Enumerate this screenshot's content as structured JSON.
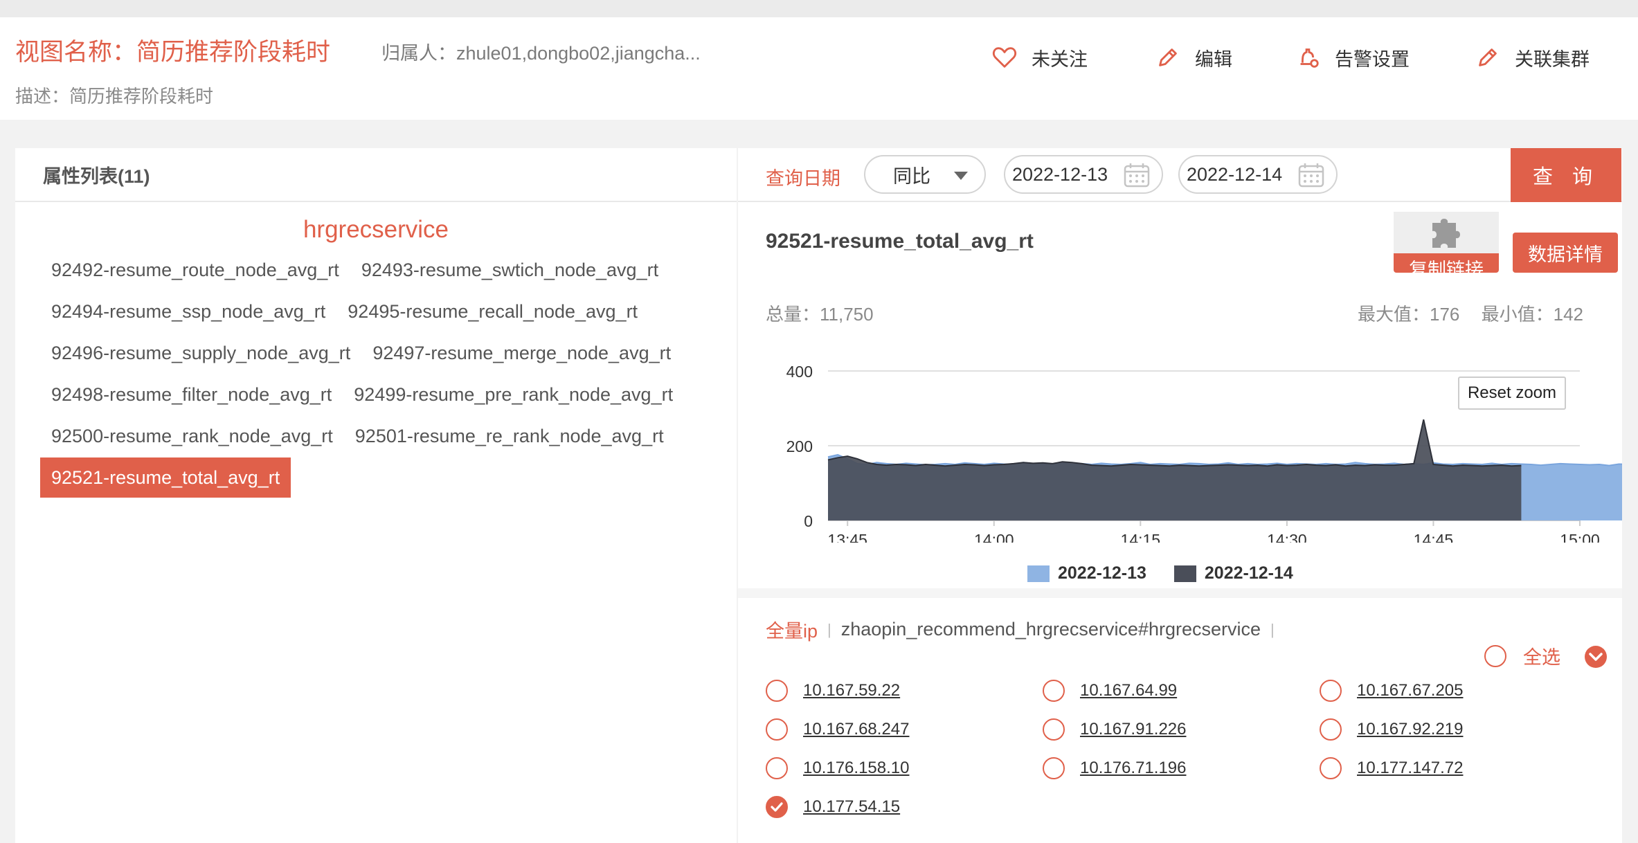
{
  "header": {
    "view_title": "视图名称：简历推荐阶段耗时",
    "owner": "归属人：zhule01,dongbo02,jiangcha...",
    "description": "描述：简历推荐阶段耗时",
    "actions": {
      "follow": "未关注",
      "edit": "编辑",
      "alert": "告警设置",
      "cluster": "关联集群"
    }
  },
  "left": {
    "list_title": "属性列表(11)",
    "service": "hrgrecservice",
    "attributes": [
      "92492-resume_route_node_avg_rt",
      "92493-resume_swtich_node_avg_rt",
      "92494-resume_ssp_node_avg_rt",
      "92495-resume_recall_node_avg_rt",
      "92496-resume_supply_node_avg_rt",
      "92497-resume_merge_node_avg_rt",
      "92498-resume_filter_node_avg_rt",
      "92499-resume_pre_rank_node_avg_rt",
      "92500-resume_rank_node_avg_rt",
      "92501-resume_re_rank_node_avg_rt",
      "92521-resume_total_avg_rt"
    ],
    "selected_index": 10
  },
  "query": {
    "label": "查询日期",
    "compare_mode": "同比",
    "date_a": "2022-12-13",
    "date_b": "2022-12-14",
    "button": "查 询"
  },
  "metric": {
    "title": "92521-resume_total_avg_rt",
    "copy_link": "复制链接",
    "detail": "数据详情",
    "total": "总量：11,750",
    "max": "最大值：176",
    "min": "最小值：142",
    "reset_zoom": "Reset zoom"
  },
  "chart_data": {
    "type": "area",
    "x_ticks": [
      "13:45",
      "14:00",
      "14:15",
      "14:30",
      "14:45",
      "15:00"
    ],
    "y_ticks": [
      "400",
      "200",
      "0"
    ],
    "ylim": [
      0,
      400
    ],
    "grid": true,
    "legend_position": "bottom",
    "series": [
      {
        "name": "2022-12-13",
        "color": "#8fb4e3",
        "x_start": "13:43",
        "x_step_min": 1,
        "values": [
          170,
          176,
          165,
          152,
          150,
          155,
          152,
          150,
          153,
          151,
          149,
          150,
          152,
          150,
          154,
          152,
          150,
          153,
          151,
          150,
          155,
          152,
          150,
          151,
          154,
          150,
          152,
          150,
          153,
          151,
          150,
          152,
          155,
          150,
          152,
          151,
          150,
          153,
          152,
          150,
          151,
          154,
          150,
          152,
          150,
          151,
          153,
          150,
          152,
          151,
          150,
          152,
          150,
          151,
          155,
          152,
          150,
          151,
          153,
          150,
          152,
          150,
          154,
          151,
          150,
          152,
          151,
          150,
          153,
          150,
          152,
          151,
          150,
          148,
          150,
          152,
          151,
          150,
          149,
          150,
          147,
          151,
          150,
          149
        ]
      },
      {
        "name": "2022-12-14",
        "color": "#4a4e59",
        "x_start": "13:43",
        "x_step_min": 1,
        "values": [
          162,
          168,
          172,
          165,
          155,
          150,
          148,
          150,
          149,
          147,
          150,
          148,
          146,
          148,
          150,
          149,
          147,
          149,
          150,
          152,
          155,
          153,
          154,
          152,
          157,
          155,
          152,
          148,
          147,
          146,
          148,
          150,
          149,
          148,
          147,
          146,
          148,
          147,
          146,
          147,
          148,
          149,
          148,
          147,
          148,
          146,
          149,
          147,
          148,
          150,
          148,
          147,
          149,
          146,
          148,
          147,
          149,
          148,
          148,
          150,
          152,
          270,
          150,
          148,
          146,
          148,
          147,
          146,
          147,
          148,
          146,
          147
        ]
      }
    ]
  },
  "ip": {
    "tab_all": "全量ip",
    "tab_service": "zhaopin_recommend_hrgrecservice#hrgrecservice",
    "select_all": "全选",
    "list": [
      {
        "ip": "10.167.59.22",
        "checked": false
      },
      {
        "ip": "10.167.64.99",
        "checked": false
      },
      {
        "ip": "10.167.67.205",
        "checked": false
      },
      {
        "ip": "10.167.68.247",
        "checked": false
      },
      {
        "ip": "10.167.91.226",
        "checked": false
      },
      {
        "ip": "10.167.92.219",
        "checked": false
      },
      {
        "ip": "10.176.158.10",
        "checked": false
      },
      {
        "ip": "10.176.71.196",
        "checked": false
      },
      {
        "ip": "10.177.147.72",
        "checked": false
      },
      {
        "ip": "10.177.54.15",
        "checked": true
      }
    ]
  }
}
